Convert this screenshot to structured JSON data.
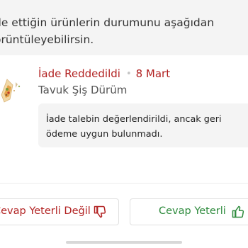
{
  "info": {
    "line1": "de ettiğin ürünlerin durumunu aşağıdan",
    "line2": "örüntüleyebilirsin."
  },
  "return_item": {
    "status_label": "İade Reddedildi",
    "separator": "•",
    "date": "8 Mart",
    "product_name": "Tavuk Şiş Dürüm",
    "message": "İade talebin değerlendirildi, ancak geri ödeme uygun bulunmadı.",
    "thumbnail_icon": "wrap-sandwich-icon"
  },
  "feedback": {
    "negative_label": "Cevap Yeterli Değil",
    "negative_icon": "thumbs-down-icon",
    "positive_label": "Cevap Yeterli",
    "positive_icon": "thumbs-up-icon"
  },
  "colors": {
    "status_red": "#b22222",
    "positive_green": "#2e8b3d",
    "panel_gray": "#f4f4f4"
  }
}
